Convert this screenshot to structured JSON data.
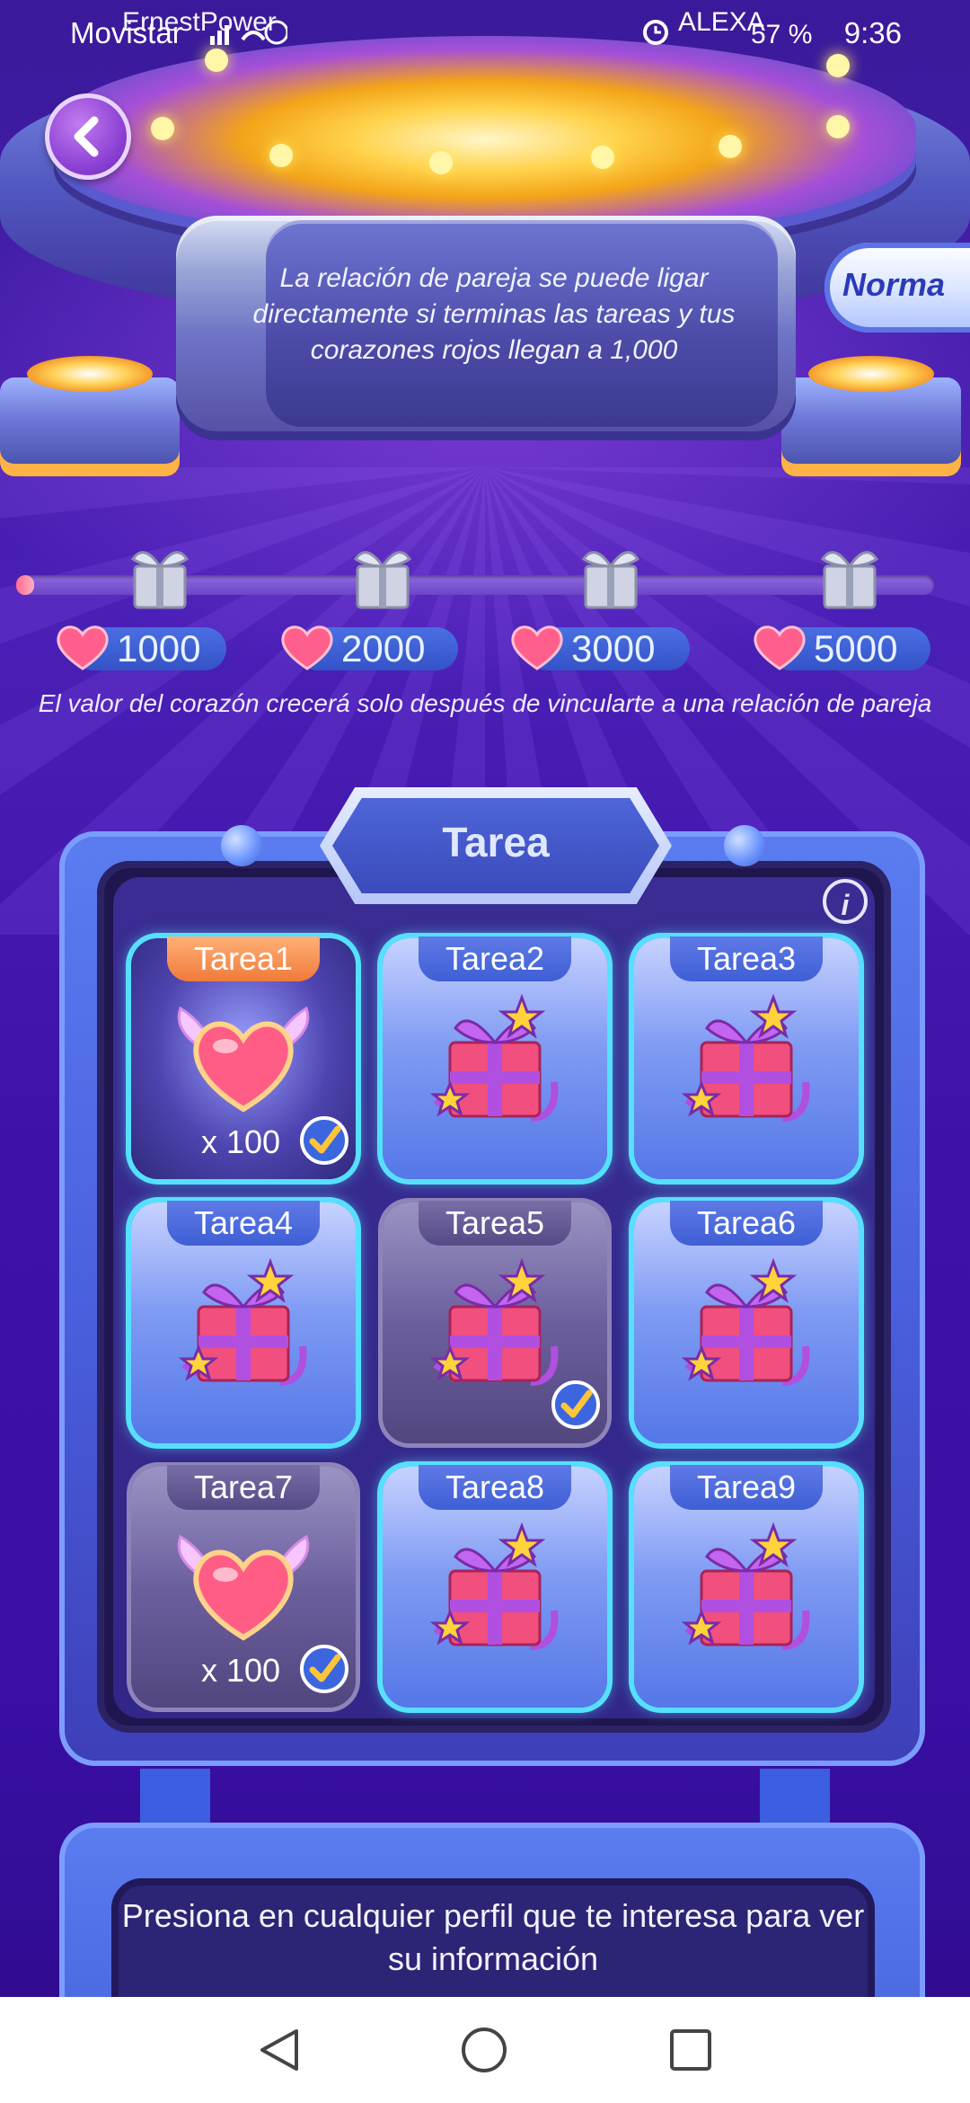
{
  "status_bar": {
    "carrier": "Movistar",
    "overlay_name": "ErnestPower",
    "alexa_label": "ALEXA",
    "battery": "57 %",
    "time": "9:36"
  },
  "header": {
    "notice": "La relación de pareja se puede ligar directamente si terminas las tareas y tus corazones rojos llegan a 1,000",
    "mode_button": "Norma"
  },
  "progress": {
    "fill_fraction": 0.02,
    "milestones": [
      {
        "value": "1000"
      },
      {
        "value": "2000"
      },
      {
        "value": "3000"
      },
      {
        "value": "5000"
      }
    ],
    "hint": "El valor del corazón crecerá solo después de vincularte a una relación de pareja"
  },
  "tasks": {
    "title": "Tarea",
    "items": [
      {
        "label": "Tarea1",
        "reward": "heart",
        "qty": "x 100",
        "state": "active",
        "completed": true
      },
      {
        "label": "Tarea2",
        "reward": "gift",
        "qty": "",
        "state": "available",
        "completed": false
      },
      {
        "label": "Tarea3",
        "reward": "gift",
        "qty": "",
        "state": "available",
        "completed": false
      },
      {
        "label": "Tarea4",
        "reward": "gift",
        "qty": "",
        "state": "available",
        "completed": false
      },
      {
        "label": "Tarea5",
        "reward": "gift",
        "qty": "",
        "state": "done",
        "completed": true
      },
      {
        "label": "Tarea6",
        "reward": "gift",
        "qty": "",
        "state": "available",
        "completed": false
      },
      {
        "label": "Tarea7",
        "reward": "heart",
        "qty": "x 100",
        "state": "done",
        "completed": true
      },
      {
        "label": "Tarea8",
        "reward": "gift",
        "qty": "",
        "state": "available",
        "completed": false
      },
      {
        "label": "Tarea9",
        "reward": "gift",
        "qty": "",
        "state": "available",
        "completed": false
      }
    ]
  },
  "bottom_panel": {
    "text": "Presiona en cualquier perfil que te interesa para ver su información"
  },
  "nav": {
    "back": "back-icon",
    "home": "home-icon",
    "recents": "recents-icon"
  }
}
